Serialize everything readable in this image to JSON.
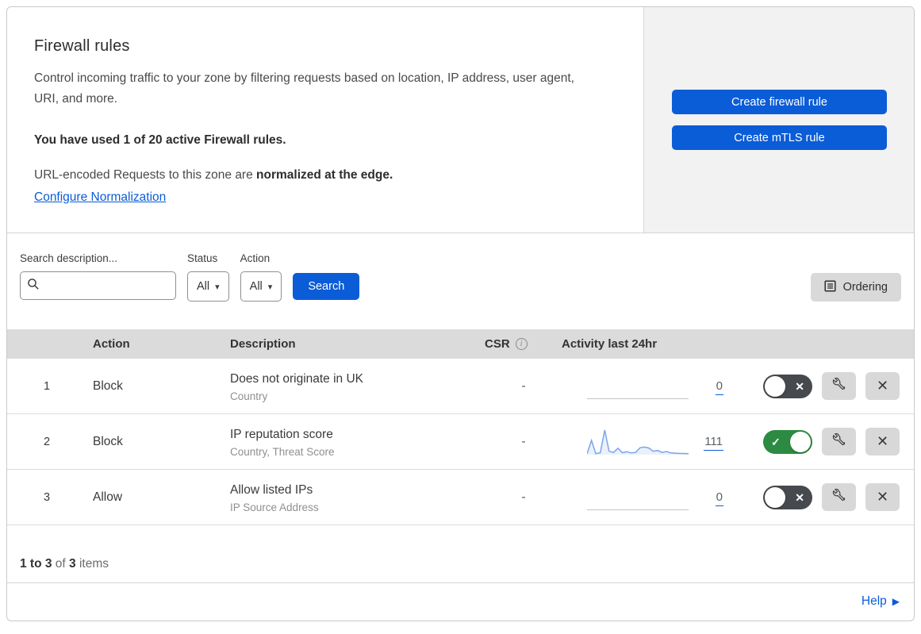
{
  "header": {
    "title": "Firewall rules",
    "description": "Control incoming traffic to your zone by filtering requests based on location, IP address, user agent, URI, and more.",
    "usage_bold": "You have used 1 of 20 active Firewall rules.",
    "normalization_text": "URL-encoded Requests to this zone are ",
    "normalization_bold": "normalized at the edge.",
    "configure_link": "Configure Normalization",
    "create_firewall_button": "Create firewall rule",
    "create_mtls_button": "Create mTLS rule"
  },
  "filters": {
    "search_label": "Search description...",
    "search_value": "",
    "status_label": "Status",
    "status_value": "All",
    "action_label": "Action",
    "action_value": "All",
    "search_button": "Search",
    "ordering_button": "Ordering"
  },
  "table": {
    "headers": {
      "action": "Action",
      "description": "Description",
      "csr": "CSR",
      "activity": "Activity last 24hr"
    },
    "rows": [
      {
        "num": "1",
        "action": "Block",
        "title": "Does not originate in UK",
        "subtitle": "Country",
        "csr": "-",
        "count": "0",
        "enabled": false,
        "sparkline": []
      },
      {
        "num": "2",
        "action": "Block",
        "title": "IP reputation score",
        "subtitle": "Country, Threat Score",
        "csr": "-",
        "count": "111",
        "enabled": true,
        "sparkline": [
          4,
          58,
          4,
          8,
          100,
          14,
          9,
          26,
          8,
          12,
          7,
          9,
          28,
          31,
          27,
          14,
          17,
          9,
          13,
          7,
          6,
          5,
          5,
          4
        ]
      },
      {
        "num": "3",
        "action": "Allow",
        "title": "Allow listed IPs",
        "subtitle": "IP Source Address",
        "csr": "-",
        "count": "0",
        "enabled": false,
        "sparkline": []
      }
    ]
  },
  "footer": {
    "range_bold": "1 to 3",
    "of_text": " of ",
    "total_bold": "3",
    "items_text": " items",
    "help_link": "Help"
  },
  "icons": {
    "dropdown_arrow": "▾",
    "toggle_check": "✓",
    "toggle_x": "✕",
    "close_x": "✕",
    "help_arrow": "▶",
    "info": "i",
    "search": "magnifier-svg",
    "wrench": "wrench-svg",
    "ordering": "list-document-svg"
  },
  "colors": {
    "accent_blue": "#0b5cd7",
    "toggle_on_green": "#2c8a43",
    "toggle_off_gray": "#46494d",
    "side_panel_gray": "#f2f2f2",
    "table_header_gray": "#dbdbdb",
    "control_gray": "#d9d9d9",
    "sparkline_stroke": "#79a5e9",
    "sparkline_fill": "#eaf1fb"
  }
}
